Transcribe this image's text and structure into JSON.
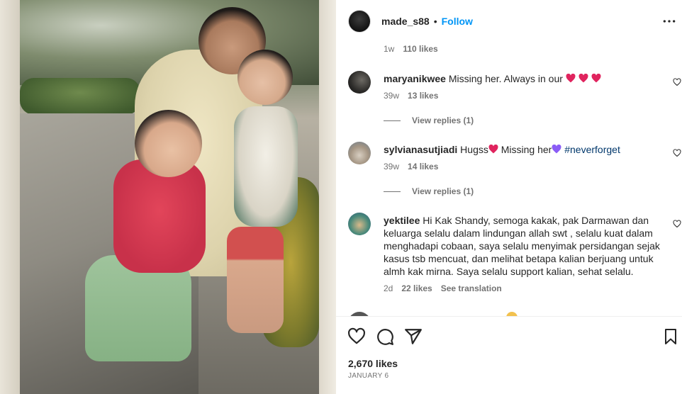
{
  "post": {
    "username": "made_s88",
    "separator": "•",
    "follow_label": "Follow",
    "likes": "2,670 likes",
    "date": "JANUARY 6"
  },
  "top_meta": {
    "time": "1w",
    "likes": "110 likes"
  },
  "comments": [
    {
      "username": "maryanikwee",
      "text": "Missing her. Always in our",
      "time": "39w",
      "likes": "13 likes",
      "replies": "View replies (1)"
    },
    {
      "username": "sylvianasutjiadi",
      "text_a": "Hugss",
      "text_b": "Missing her",
      "hashtag": "#neverforget",
      "time": "39w",
      "likes": "14 likes",
      "replies": "View replies (1)"
    },
    {
      "username": "yektilee",
      "text": "Hi Kak Shandy, semoga kakak, pak Darmawan dan keluarga selalu dalam lindungan allah swt , selalu kuat dalam menghadapi cobaan, saya selalu menyimak persidangan sejak kasus tsb mencuat, dan melihat betapa kalian berjuang untuk almh kak mirna. Saya selalu support kalian, sehat selalu.",
      "time": "2d",
      "likes": "22 likes",
      "see_translation": "See translation"
    }
  ],
  "colors": {
    "accent": "#0095f6",
    "text": "#262626",
    "secondary": "#737373",
    "heart_red": "#e0245e",
    "heart_purple": "#8b5cf6",
    "hashtag": "#00376b"
  },
  "icons": {
    "more": "more-horizontal-icon",
    "like": "heart-outline-icon",
    "comment": "comment-bubble-icon",
    "share": "paper-plane-icon",
    "save": "bookmark-icon"
  }
}
